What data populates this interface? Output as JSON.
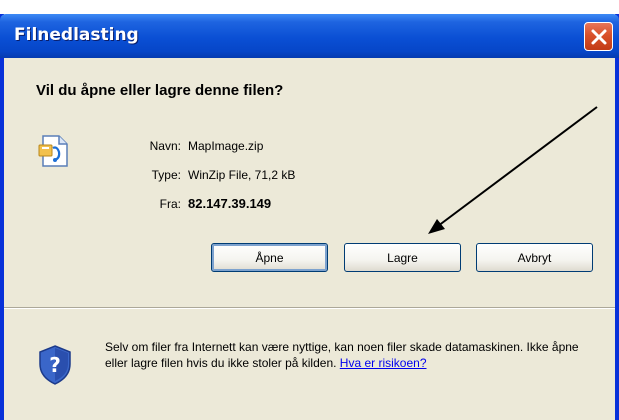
{
  "window": {
    "title": "Filnedlasting"
  },
  "dialog": {
    "question": "Vil du åpne eller lagre denne filen?",
    "fields": {
      "name_label": "Navn:",
      "name_value": "MapImage.zip",
      "type_label": "Type:",
      "type_value": "WinZip File, 71,2 kB",
      "from_label": "Fra:",
      "from_value": "82.147.39.149"
    },
    "buttons": {
      "open": "Åpne",
      "save": "Lagre",
      "cancel": "Avbryt"
    },
    "warning": {
      "text": "Selv om filer fra Internett kan være nyttige, kan noen filer skade datamaskinen. Ikke åpne eller lagre filen hvis du ikke stoler på kilden.",
      "link": "Hva er risikoen?"
    }
  },
  "icons": {
    "file": "zip-file-icon",
    "shield": "shield-question-icon",
    "close": "close-icon"
  },
  "colors": {
    "titlebar": "#0a4fd4",
    "dialog_bg": "#ece9d8",
    "close_button": "#d9512a",
    "link": "#0000ee"
  }
}
